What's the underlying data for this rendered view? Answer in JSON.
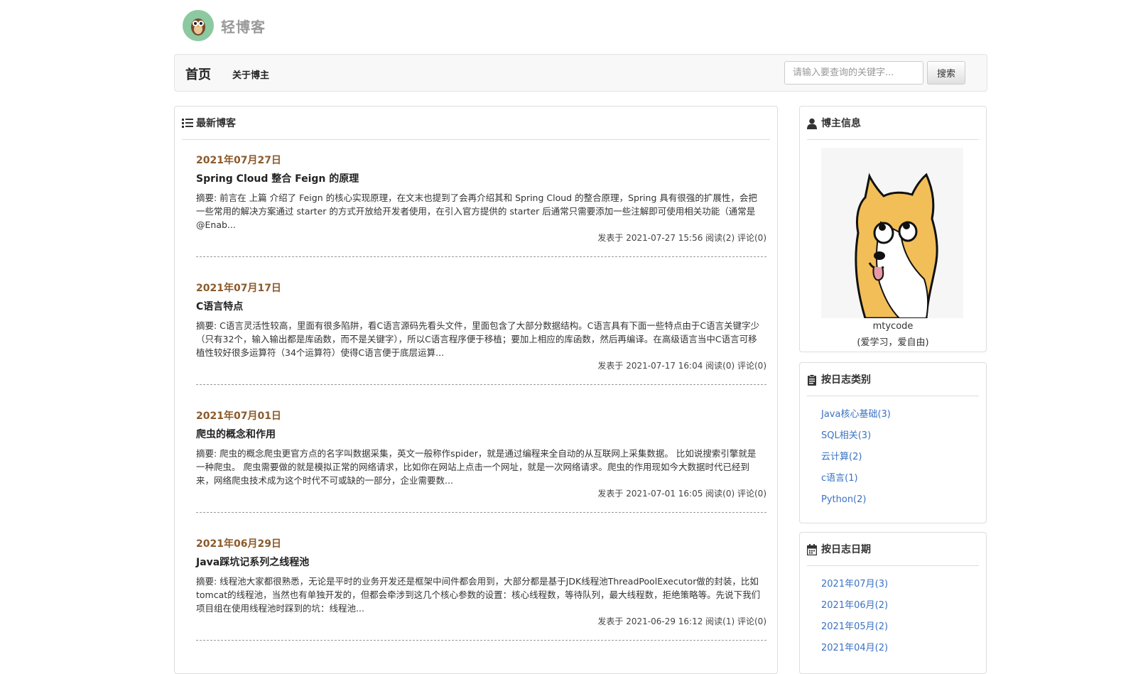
{
  "site": {
    "logo_text": "轻博客"
  },
  "nav": {
    "home": "首页",
    "about": "关于博主",
    "search_placeholder": "请输入要查询的关键字...",
    "search_button": "搜索"
  },
  "latest": {
    "title": "最新博客",
    "posts": [
      {
        "date": "2021年07月27日",
        "title": "Spring Cloud 整合 Feign 的原理",
        "summary": "摘要: 前言在 上篇 介绍了 Feign 的核心实现原理，在文末也提到了会再介绍其和 Spring Cloud 的整合原理，Spring 具有很强的扩展性，会把一些常用的解决方案通过 starter 的方式开放给开发者使用，在引入官方提供的 starter 后通常只需要添加一些注解即可使用相关功能（通常是 @Enab...",
        "meta": "发表于 2021-07-27 15:56 阅读(2) 评论(0)"
      },
      {
        "date": "2021年07月17日",
        "title": "C语言特点",
        "summary": "摘要: C语言灵活性较高，里面有很多陷阱，看C语言源码先看头文件，里面包含了大部分数据结构。C语言具有下面一些特点由于C语言关键字少（只有32个，输入输出都是库函数，而不是关键字），所以C语言程序便于移植；要加上相应的库函数，然后再编译。在高级语言当中C语言可移植性较好很多运算符（34个运算符）使得C语言便于底层运算...",
        "meta": "发表于 2021-07-17 16:04 阅读(0) 评论(0)"
      },
      {
        "date": "2021年07月01日",
        "title": "爬虫的概念和作用",
        "summary": "摘要: 爬虫的概念爬虫更官方点的名字叫数据采集，英文一般称作spider，就是通过编程来全自动的从互联网上采集数据。 比如说搜索引擎就是一种爬虫。 爬虫需要做的就是模拟正常的网络请求，比如你在网站上点击一个网址，就是一次网络请求。爬虫的作用现如今大数据时代已经到来，网络爬虫技术成为这个时代不可或缺的一部分，企业需要数...",
        "meta": "发表于 2021-07-01 16:05 阅读(0) 评论(0)"
      },
      {
        "date": "2021年06月29日",
        "title": "Java踩坑记系列之线程池",
        "summary": "摘要: 线程池大家都很熟悉，无论是平时的业务开发还是框架中间件都会用到，大部分都是基于JDK线程池ThreadPoolExecutor做的封装，比如tomcat的线程池，当然也有单独开发的，但都会牵涉到这几个核心参数的设置：核心线程数，等待队列，最大线程数，拒绝策略等。先说下我们项目组在使用线程池时踩到的坑：线程池...",
        "meta": "发表于 2021-06-29 16:12 阅读(1) 评论(0)"
      }
    ]
  },
  "author": {
    "title": "博主信息",
    "name": "mtycode",
    "motto": "(爱学习，爱自由)"
  },
  "categories": {
    "title": "按日志类别",
    "items": [
      "Java核心基础(3)",
      "SQL相关(3)",
      "云计算(2)",
      "c语言(1)",
      "Python(2)"
    ]
  },
  "dates": {
    "title": "按日志日期",
    "items": [
      "2021年07月(3)",
      "2021年06月(2)",
      "2021年05月(2)",
      "2021年04月(2)"
    ]
  },
  "colors": {
    "accent": "#8b5a2b",
    "link": "#3a72c4"
  }
}
